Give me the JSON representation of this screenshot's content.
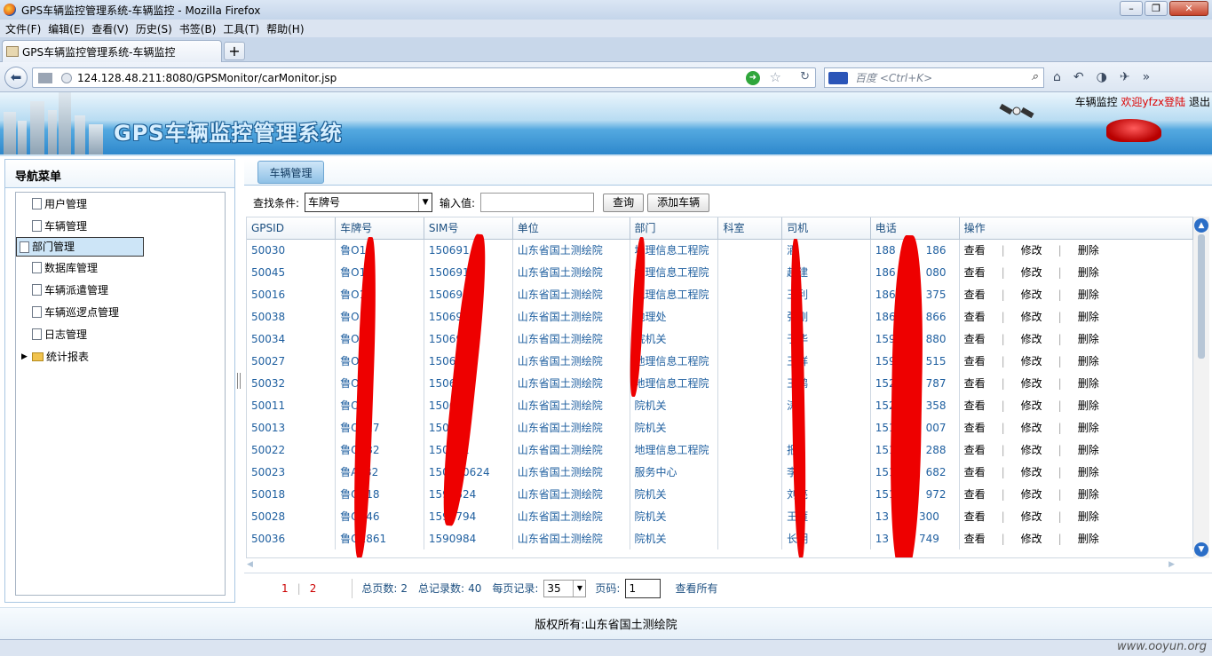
{
  "window": {
    "title": "GPS车辆监控管理系统-车辆监控 - Mozilla Firefox"
  },
  "menubar": [
    "文件(F)",
    "编辑(E)",
    "查看(V)",
    "历史(S)",
    "书签(B)",
    "工具(T)",
    "帮助(H)"
  ],
  "browser_tab": {
    "title": "GPS车辆监控管理系统-车辆监控",
    "new_tab": "+"
  },
  "address": {
    "url": "124.128.48.211:8080/GPSMonitor/carMonitor.jsp"
  },
  "search": {
    "placeholder": "百度 <Ctrl+K>"
  },
  "header": {
    "title": "GPS车辆监控管理系统",
    "link_monitor": "车辆监控",
    "welcome": "欢迎yfzx登陆",
    "logout": "退出"
  },
  "sidebar": {
    "title": "导航菜单",
    "items": [
      {
        "label": "用户管理"
      },
      {
        "label": "车辆管理"
      },
      {
        "label": "部门管理"
      },
      {
        "label": "数据库管理"
      },
      {
        "label": "车辆派遣管理"
      },
      {
        "label": "车辆巡逻点管理"
      },
      {
        "label": "日志管理"
      },
      {
        "label": "统计报表"
      }
    ],
    "selected_index": 2
  },
  "main": {
    "tab": "车辆管理",
    "query_label": "查找条件:",
    "query_field": "车牌号",
    "input_label": "输入值:",
    "input_value": "",
    "search_button": "查询",
    "add_button": "添加车辆"
  },
  "table": {
    "columns": [
      "GPSID",
      "车牌号",
      "SIM号",
      "单位",
      "部门",
      "科室",
      "司机",
      "电话",
      "操作"
    ],
    "actions": {
      "view": "查看",
      "edit": "修改",
      "delete": "删除"
    },
    "rows": [
      [
        "50030",
        "鲁O19",
        "150691",
        "山东省国土测绘院",
        "地理信息工程院",
        "",
        "酒",
        "188",
        "186"
      ],
      [
        "50045",
        "鲁O13",
        "150691",
        "山东省国土测绘院",
        "地理信息工程院",
        "",
        "赵建",
        "186",
        "080"
      ],
      [
        "50016",
        "鲁O18",
        "150691",
        "山东省国土测绘院",
        "地理信息工程院",
        "",
        "王利",
        "186",
        "375"
      ],
      [
        "50038",
        "鲁O13",
        "150691",
        "山东省国土测绘院",
        "地理处",
        "",
        "张刚",
        "186",
        "866"
      ],
      [
        "50034",
        "鲁O19",
        "150691",
        "山东省国土测绘院",
        "院机关",
        "",
        "于华",
        "159",
        "880"
      ],
      [
        "50027",
        "鲁O19",
        "150691",
        "山东省国土测绘院",
        "地理信息工程院",
        "",
        "王祥",
        "159",
        "515"
      ],
      [
        "50032",
        "鲁O13",
        "150691",
        "山东省国土测绘院",
        "地理信息工程院",
        "",
        "王鹏",
        "152",
        "787"
      ],
      [
        "50011",
        "鲁O15",
        "150691",
        "山东省国土测绘院",
        "院机关",
        "",
        "涛",
        "152",
        "358"
      ],
      [
        "50013",
        "鲁O127",
        "150691",
        "山东省国土测绘院",
        "院机关",
        "",
        "",
        "151",
        "007"
      ],
      [
        "50022",
        "鲁O232",
        "150691",
        "山东省国土测绘院",
        "地理信息工程院",
        "",
        "报",
        "151",
        "288"
      ],
      [
        "50023",
        "鲁A732",
        "150690624",
        "山东省国土测绘院",
        "服务中心",
        "",
        "李",
        "151",
        "682"
      ],
      [
        "50018",
        "鲁O318",
        "1590524",
        "山东省国土测绘院",
        "院机关",
        "",
        "刘亮",
        "151",
        "972"
      ],
      [
        "50028",
        "鲁O846",
        "1590794",
        "山东省国土测绘院",
        "院机关",
        "",
        "王雁",
        "13",
        "300"
      ],
      [
        "50036",
        "鲁O1861",
        "1590984",
        "山东省国土测绘院",
        "院机关",
        "",
        "长明",
        "13",
        "749"
      ]
    ]
  },
  "pager": {
    "page1": "1",
    "page2": "2",
    "total_pages_label": "总页数:",
    "total_pages": "2",
    "total_records_label": "总记录数:",
    "total_records": "40",
    "per_page_label": "每页记录:",
    "per_page": "35",
    "page_label": "页码:",
    "page_value": "1",
    "view_all": "查看所有"
  },
  "footer": {
    "copyright": "版权所有:山东省国土测绘院"
  },
  "statusbar": {
    "watermark": "www.ooyun.org"
  },
  "colors": {
    "accent": "#2e88cc",
    "link": "#2060a0",
    "selected": "#cde5f7",
    "redaction": "#ee0000"
  }
}
